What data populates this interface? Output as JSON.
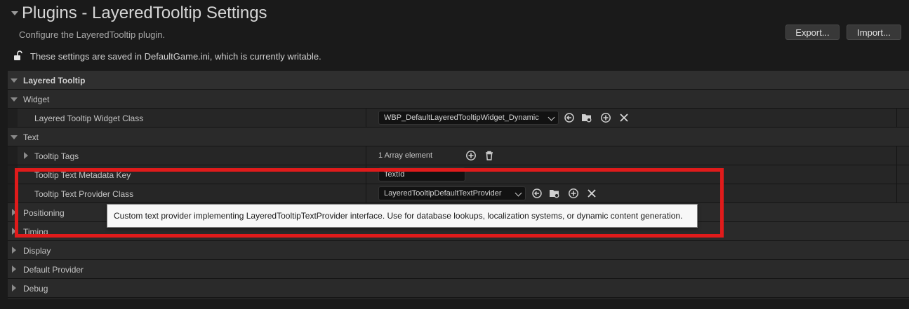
{
  "header": {
    "title": "Plugins - LayeredTooltip Settings",
    "subtitle": "Configure the LayeredTooltip plugin.",
    "export_label": "Export...",
    "import_label": "Import...",
    "info": "These settings are saved in DefaultGame.ini, which is currently writable."
  },
  "sections": {
    "layered_tooltip": "Layered Tooltip",
    "widget": "Widget",
    "text": "Text",
    "positioning": "Positioning",
    "timing": "Timing",
    "display": "Display",
    "default_provider": "Default Provider",
    "debug": "Debug"
  },
  "properties": {
    "widget_class": {
      "label": "Layered Tooltip Widget Class",
      "value": "WBP_DefaultLayeredTooltipWidget_Dynamic"
    },
    "tooltip_tags": {
      "label": "Tooltip Tags",
      "value": "1 Array element"
    },
    "metadata_key": {
      "label": "Tooltip Text Metadata Key",
      "value": "TextId"
    },
    "provider_class": {
      "label": "Tooltip Text Provider Class",
      "value": "LayeredTooltipDefaultTextProvider"
    }
  },
  "tooltip": {
    "text": "Custom text provider implementing LayeredTooltipTextProvider interface. Use for database lookups, localization systems, or dynamic content generation."
  },
  "colors": {
    "background": "#1a1a1a",
    "highlight": "#e01b1b",
    "tooltip_bg": "#f7f7f7"
  }
}
